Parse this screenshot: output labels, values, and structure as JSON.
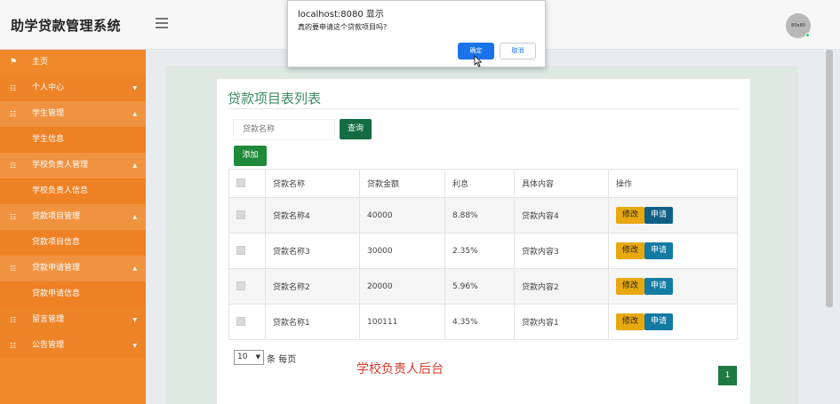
{
  "header": {
    "brand": "助学贷款管理系统",
    "avatar_text": "80x80"
  },
  "sidebar": {
    "items": [
      {
        "label": "主页",
        "icon": "flag-icon",
        "type": "top"
      },
      {
        "label": "个人中心",
        "icon": "grid-icon",
        "type": "group",
        "caret": "▼"
      },
      {
        "label": "学生管理",
        "icon": "grid-icon",
        "type": "group-open",
        "caret": "▲"
      },
      {
        "label": "学生信息",
        "type": "sub"
      },
      {
        "label": "学校负责人管理",
        "icon": "grid-icon",
        "type": "group-open",
        "caret": "▲"
      },
      {
        "label": "学校负责人信息",
        "type": "sub"
      },
      {
        "label": "贷款项目管理",
        "icon": "grid-icon",
        "type": "group-open",
        "caret": "▲"
      },
      {
        "label": "贷款项目信息",
        "type": "sub"
      },
      {
        "label": "贷款申请管理",
        "icon": "grid-icon",
        "type": "group-open",
        "caret": "▲"
      },
      {
        "label": "贷款申请信息",
        "type": "sub"
      },
      {
        "label": "留言管理",
        "icon": "grid-icon",
        "type": "group",
        "caret": "▼"
      },
      {
        "label": "公告管理",
        "icon": "grid-icon",
        "type": "group",
        "caret": "▼"
      }
    ]
  },
  "main": {
    "title": "贷款项目表列表",
    "search_placeholder": "贷款名称",
    "search_label": "查询",
    "add_label": "添加",
    "columns": [
      "贷款名称",
      "贷款金额",
      "利息",
      "具体内容",
      "操作"
    ],
    "rows": [
      {
        "name": "贷款名称4",
        "amount": "40000",
        "interest": "8.88%",
        "content": "贷款内容4"
      },
      {
        "name": "贷款名称3",
        "amount": "30000",
        "interest": "2.35%",
        "content": "贷款内容3"
      },
      {
        "name": "贷款名称2",
        "amount": "20000",
        "interest": "5.96%",
        "content": "贷款内容2"
      },
      {
        "name": "贷款名称1",
        "amount": "100111",
        "interest": "4.35%",
        "content": "贷款内容1"
      }
    ],
    "edit_label": "修改",
    "apply_label": "申请",
    "page_size": "10",
    "page_size_suffix": "条 每页",
    "current_page": "1",
    "watermark": "学校负责人后台"
  },
  "dialog": {
    "title": "localhost:8080 显示",
    "message": "真的要申请这个贷款项目吗?",
    "ok_label": "确定",
    "cancel_label": "取消"
  },
  "colors": {
    "sidebar": "#f0882c",
    "accent_green": "#146c43",
    "title_green": "#3d8b62",
    "edit_button": "#e8a90f",
    "apply_button": "#137aa4",
    "watermark_red": "#d63a2a",
    "dialog_blue": "#1a73e8"
  }
}
